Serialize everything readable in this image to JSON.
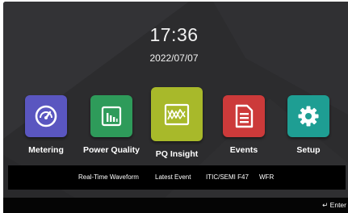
{
  "status": {
    "time": "17:36",
    "date": "2022/07/07"
  },
  "tiles": [
    {
      "label": "Metering",
      "icon": "gauge-icon",
      "color": "#5a56c0"
    },
    {
      "label": "Power Quality",
      "icon": "bar-chart-icon",
      "color": "#2e9b5a"
    },
    {
      "label": "PQ Insight",
      "icon": "waveform-icon",
      "color": "#a8b92a",
      "selected": true
    },
    {
      "label": "Events",
      "icon": "document-icon",
      "color": "#cc3a3a"
    },
    {
      "label": "Setup",
      "icon": "gear-icon",
      "color": "#1e9e93"
    }
  ],
  "menu": {
    "items": [
      "Real-Time Waveform",
      "Latest Event",
      "ITIC/SEMI F47",
      "WFR"
    ]
  },
  "footer": {
    "enter_label": "Enter",
    "enter_icon": "enter-arrow-icon"
  },
  "colors": {
    "background": "#2c2c2e",
    "menu_bar": "#000000"
  }
}
